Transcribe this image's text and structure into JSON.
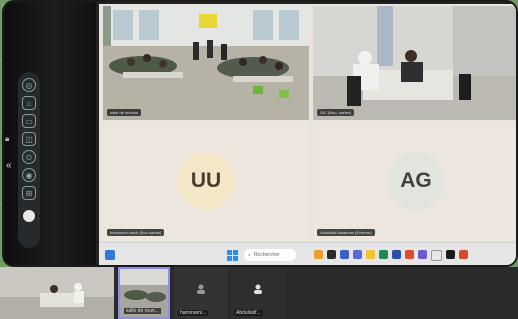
{
  "tiles": [
    {
      "label": "salle de reunion",
      "initials": ""
    },
    {
      "label": "DIC (Bou- sarfan)",
      "initials": ""
    },
    {
      "label": "hammami ulrich (Bou sarfan)",
      "initials": "UU"
    },
    {
      "label": "Abdullatif Alsabhan (Externe)",
      "initials": "AG"
    }
  ],
  "taskbar": {
    "search_placeholder": "Rechercher"
  },
  "thumbnails": [
    {
      "label": ""
    },
    {
      "label": "salle de reun..."
    },
    {
      "label": "hammami..."
    },
    {
      "label": "Abdullatif..."
    }
  ],
  "colors": {
    "accent": "#8e8ef0",
    "taskbar": "#e6e6e6",
    "uu_avatar": "#f4e7c8",
    "ag_avatar": "#e1e5dd"
  }
}
